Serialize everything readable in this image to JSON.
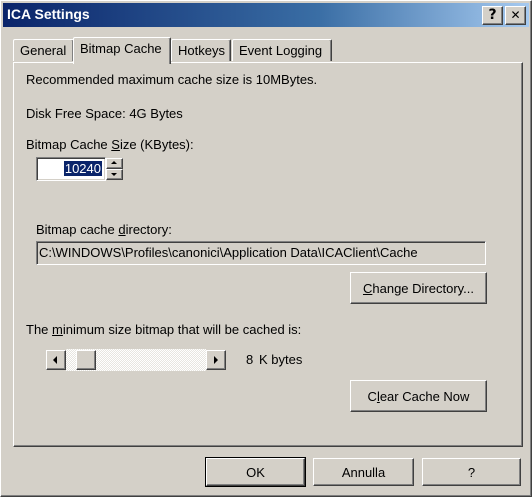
{
  "window": {
    "title": "ICA Settings",
    "help_button": "?",
    "close_button": "✕"
  },
  "tabs": [
    {
      "label": "General",
      "active": false
    },
    {
      "label": "Bitmap Cache",
      "active": true
    },
    {
      "label": "Hotkeys",
      "active": false
    },
    {
      "label": "Event Logging",
      "active": false
    }
  ],
  "bitmap_cache": {
    "recommended_text": "Recommended maximum cache size is 10MBytes.",
    "disk_free_space": "Disk Free Space: 4G Bytes",
    "cache_size_label_pre": "Bitmap Cache ",
    "cache_size_label_key": "S",
    "cache_size_label_post": "ize (KBytes):",
    "cache_size_value": "10240",
    "directory_label_pre": "Bitmap cache ",
    "directory_label_key": "d",
    "directory_label_post": "irectory:",
    "directory_value": "C:\\WINDOWS\\Profiles\\canonici\\Application Data\\ICAClient\\Cache",
    "change_dir_key": "C",
    "change_dir_rest": "hange Directory...",
    "min_size_label_pre": "The ",
    "min_size_label_key": "m",
    "min_size_label_post": "inimum size bitmap that will be cached is:",
    "min_size_value": "8",
    "min_size_unit": "K bytes",
    "min_size_slider_fraction": 0.0,
    "clear_pre": "C",
    "clear_key": "l",
    "clear_post": "ear Cache Now"
  },
  "footer": {
    "ok_label": "OK",
    "cancel_label": "Annulla",
    "help_label": "?"
  }
}
